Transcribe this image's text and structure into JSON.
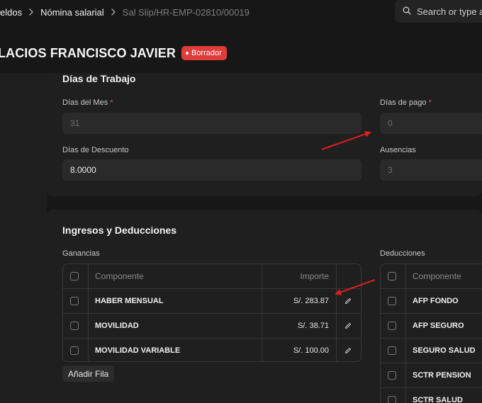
{
  "breadcrumbs": [
    {
      "label": "eldos"
    },
    {
      "label": "Nómina salarial"
    },
    {
      "label": "Sal Slip/HR-EMP-02810/00019"
    }
  ],
  "search": {
    "placeholder": "Search or type a"
  },
  "title": "LACIOS FRANCISCO JAVIER",
  "status_badge": {
    "label": "Borrador",
    "color": "#e03c3c"
  },
  "working_days": {
    "title": "Días de Trabajo",
    "fields": {
      "days_in_month": {
        "label": "Días del Mes",
        "required": "*",
        "value": "31"
      },
      "payment_days": {
        "label": "Días de pago",
        "required": "*",
        "value": "0"
      },
      "discount_days": {
        "label": "Días de Descuento",
        "value": "8.0000"
      },
      "absences": {
        "label": "Ausencias",
        "value": "3"
      }
    }
  },
  "earnings_deductions": {
    "title": "Ingresos y Deducciones",
    "earnings": {
      "label": "Ganancias",
      "columns": {
        "component": "Componente",
        "amount": "Importe"
      },
      "rows": [
        {
          "component": "HABER MENSUAL",
          "amount": "S/. 283.87"
        },
        {
          "component": "MOVILIDAD",
          "amount": "S/. 38.71"
        },
        {
          "component": "MOVILIDAD VARIABLE",
          "amount": "S/. 100.00"
        }
      ],
      "add_row_label": "Añadir Fila"
    },
    "deductions": {
      "label": "Deducciones",
      "columns": {
        "component": "Componente"
      },
      "rows": [
        {
          "component": "AFP FONDO"
        },
        {
          "component": "AFP SEGURO"
        },
        {
          "component": "SEGURO SALUD"
        },
        {
          "component": "SCTR PENSION"
        },
        {
          "component": "SCTR SALUD"
        }
      ]
    }
  },
  "annotation_color": "#e01e1e"
}
